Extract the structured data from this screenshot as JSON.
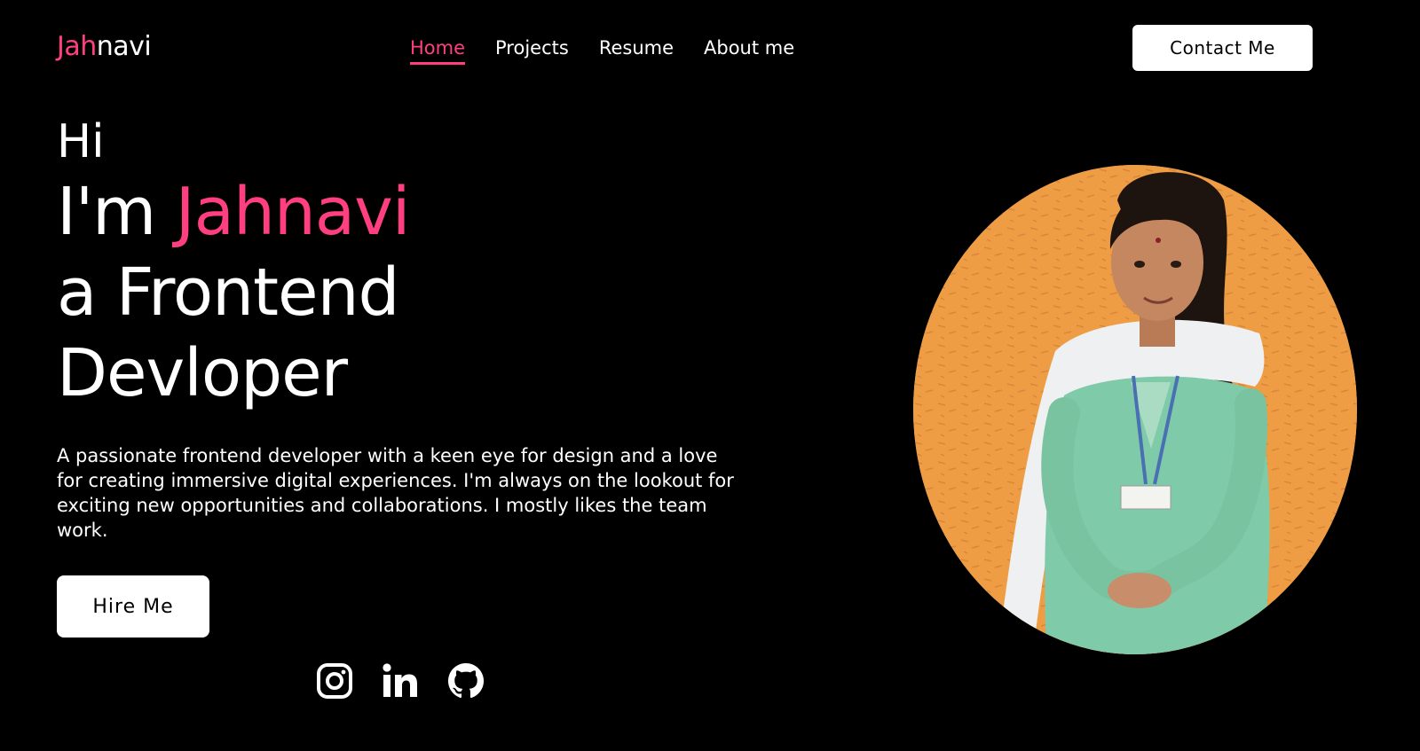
{
  "logo": {
    "accent": "Jah",
    "rest": "navi"
  },
  "nav": {
    "items": [
      {
        "label": "Home",
        "active": true
      },
      {
        "label": "Projects",
        "active": false
      },
      {
        "label": "Resume",
        "active": false
      },
      {
        "label": "About me",
        "active": false
      }
    ]
  },
  "header": {
    "contact_label": "Contact Me"
  },
  "hero": {
    "greeting": "Hi",
    "intro_prefix": "I'm ",
    "name": "Jahnavi",
    "role_line1": "a Frontend",
    "role_line2": "Devloper",
    "description": "A passionate frontend developer with a keen eye for design and a love for creating immersive digital experiences. I'm always on the lookout for exciting new opportunities and collaborations. I mostly likes the team work.",
    "hire_label": "Hire Me"
  },
  "socials": [
    {
      "icon": "instagram-icon"
    },
    {
      "icon": "linkedin-icon"
    },
    {
      "icon": "github-icon"
    }
  ],
  "portrait": {
    "icon": "profile-photo"
  },
  "colors": {
    "background": "#000000",
    "accent": "#ff3f7f",
    "text": "#ffffff",
    "button_bg": "#ffffff",
    "button_text": "#000000",
    "photo_wall": "#f0a048",
    "dress": "#7fcaa8"
  }
}
